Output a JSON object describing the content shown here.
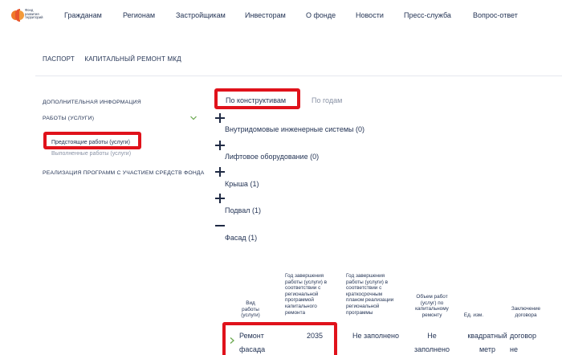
{
  "header": {
    "logo_lines": [
      "Фонд",
      "развития",
      "территорий"
    ],
    "nav": [
      "Гражданам",
      "Регионам",
      "Застройщикам",
      "Инвесторам",
      "О фонде",
      "Новости",
      "Пресс-служба",
      "Вопрос-ответ"
    ]
  },
  "subnav": [
    "ПАСПОРТ",
    "КАПИТАЛЬНЫЙ РЕМОНТ МКД"
  ],
  "sidebar": {
    "additional_info": "ДОПОЛНИТЕЛЬНАЯ ИНФОРМАЦИЯ",
    "works": "РАБОТЫ (УСЛУГИ)",
    "upcoming": "Предстоящие работы (услуги)",
    "completed": "Выполненные работы (услуги)",
    "programs": "РЕАЛИЗАЦИЯ ПРОГРАММ С УЧАСТИЕМ СРЕДСТВ ФОНДА"
  },
  "tabs": {
    "by_structure": "По конструктивам",
    "by_year": "По годам"
  },
  "accordion": [
    {
      "label": "Внутридомовые инженерные системы (0)",
      "expanded": false
    },
    {
      "label": "Лифтовое оборудование (0)",
      "expanded": false
    },
    {
      "label": "Крыша (1)",
      "expanded": false
    },
    {
      "label": "Подвал (1)",
      "expanded": false
    },
    {
      "label": "Фасад (1)",
      "expanded": true
    }
  ],
  "table": {
    "headers": {
      "type": "Вид\nработы\n(услуги)",
      "year_regional": "Год завершения\nработы (услуги) в\nсоответствии с\nрегиональной\nпрограммой\nкапитального\nремонта",
      "year_short": "Год завершения\nработы (услуги) в\nсоответствии с\nкраткосрочным\nпланом реализации\nрегиональной\nпрограммы",
      "volume": "Объем работ\n(услуг) по\nкапитальному\nремонту",
      "unit": "Ед. изм.",
      "contract": "Заключение\nдоговора"
    },
    "row": {
      "type": "Ремонт\nфасада",
      "year_regional": "2035",
      "year_short": "Не заполнено",
      "volume": "Не\nзаполнено",
      "unit": "квадратный\nметр",
      "contract": "договор\nне"
    }
  },
  "colors": {
    "accent_red": "#e0121b",
    "text_dark": "#243455",
    "text_muted": "#8a93a6",
    "chevron_green": "#6aa84f"
  }
}
